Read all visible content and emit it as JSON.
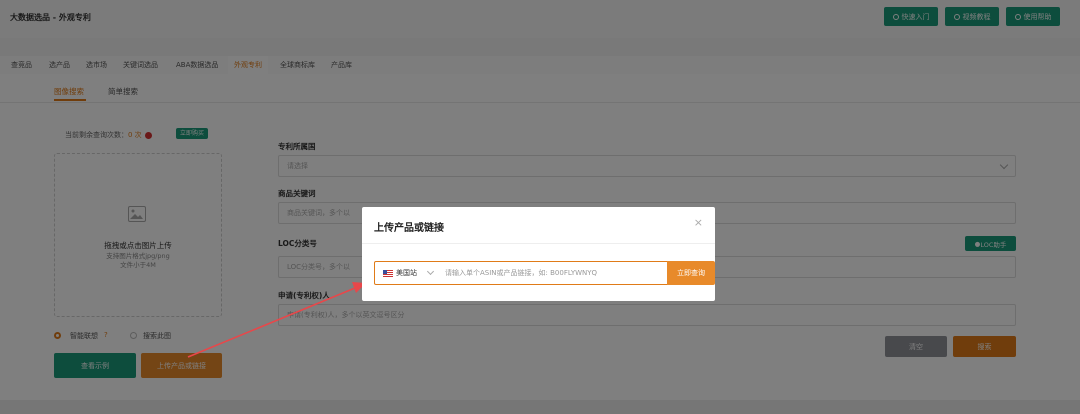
{
  "header": {
    "app_title": "大数据选品 - 外观专利",
    "buttons": [
      {
        "label": "快速入门",
        "icon": "circle-icon"
      },
      {
        "label": "视频教程",
        "icon": "play-icon"
      },
      {
        "label": "使用帮助",
        "icon": "help-icon"
      }
    ]
  },
  "tabs": [
    "查竞品",
    "选产品",
    "选市场",
    "关键词选品",
    "ABA数据选品",
    "外观专利",
    "全球商标库",
    "产品库"
  ],
  "active_tab": "外观专利",
  "subtabs": [
    "图像搜索",
    "简单搜索"
  ],
  "active_subtab": "图像搜索",
  "quota": {
    "prefix": "当前剩余查询次数：",
    "count": "0 次",
    "buy_label": "立即购买"
  },
  "upload": {
    "title": "拖拽或点击图片上传",
    "hint1": "支持图片格式jpg/png",
    "hint2": "文件小于4M"
  },
  "radios": [
    {
      "label": "智能联想",
      "checked": true
    },
    {
      "label": "搜索此图",
      "checked": false
    }
  ],
  "left_buttons": {
    "example": "查看示例",
    "upload_link": "上传产品或链接"
  },
  "form": {
    "country_label": "专利所属国",
    "country_placeholder": "请选择",
    "keyword_label": "商品关键词",
    "keyword_placeholder": "商品关键词，多个以",
    "loc_label": "LOC分类号",
    "loc_placeholder": "LOC分类号，多个以",
    "loc_helper": "LOC助手",
    "applicant_label": "申请(专利权)人",
    "applicant_placeholder": "申请(专利权)人，多个以英文逗号区分",
    "reset": "清空",
    "search": "搜索"
  },
  "modal": {
    "title": "上传产品或链接",
    "site": "美国站",
    "placeholder": "请输入单个ASIN或产品链接，如: B00FLYWNYQ",
    "submit": "立即查询"
  },
  "colors": {
    "accent": "#e07b18",
    "green": "#1a9b7a",
    "arrow": "#e8474a"
  }
}
